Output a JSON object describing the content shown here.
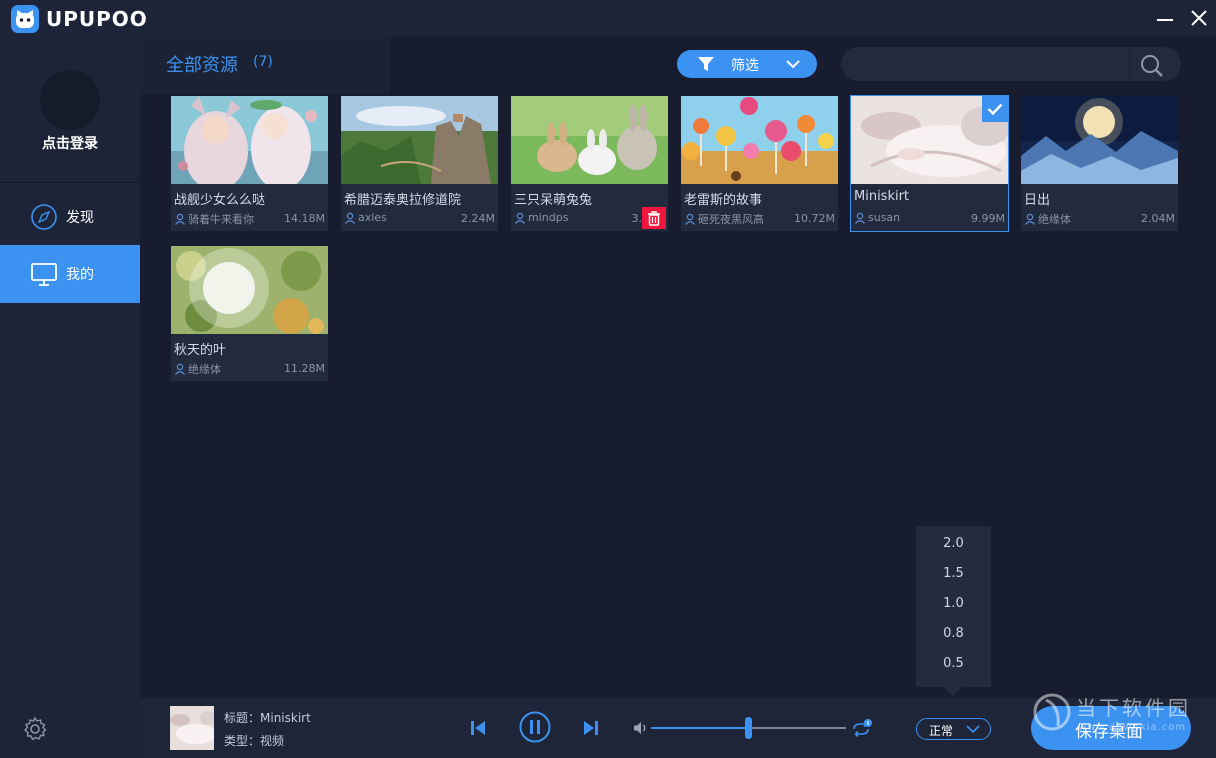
{
  "app": {
    "brand": "UPUPOO"
  },
  "sidebar": {
    "login_label": "点击登录",
    "items": [
      {
        "label": "发现",
        "icon": "compass-icon",
        "active": false
      },
      {
        "label": "我的",
        "icon": "monitor-icon",
        "active": true
      }
    ]
  },
  "header": {
    "title": "全部资源",
    "count": "(7)",
    "filter_label": "筛选",
    "search_placeholder": ""
  },
  "cards": [
    {
      "title": "战舰少女么么哒",
      "author": "骑着牛来看你",
      "size": "14.18M",
      "selected": false
    },
    {
      "title": "希腊迈泰奥拉修道院",
      "author": "axles",
      "size": "2.24M",
      "selected": false
    },
    {
      "title": "三只呆萌兔兔",
      "author": "mindps",
      "size": "3.",
      "selected": false
    },
    {
      "title": "老雷斯的故事",
      "author": "砸死夜黑风高",
      "size": "10.72M",
      "selected": false
    },
    {
      "title": "Miniskirt",
      "author": "susan",
      "size": "9.99M",
      "selected": true
    },
    {
      "title": "日出",
      "author": "绝缘体",
      "size": "2.04M",
      "selected": false
    },
    {
      "title": "秋天的叶",
      "author": "绝缘体",
      "size": "11.28M",
      "selected": false
    }
  ],
  "speed_menu": {
    "options": [
      "2.0",
      "1.5",
      "1.0",
      "0.8",
      "0.5"
    ]
  },
  "player": {
    "title_line": "标题：Miniskirt",
    "type_line": "类型：视频",
    "volume": 0.5,
    "speed_label": "正常",
    "save_label": "保存桌面"
  },
  "watermark": {
    "text": "当下软件园",
    "url": "www.downxia.com"
  },
  "colors": {
    "accent": "#3c92f1",
    "background": "#171d2f",
    "sidebar": "#1d2438",
    "delete": "#f0163d"
  }
}
